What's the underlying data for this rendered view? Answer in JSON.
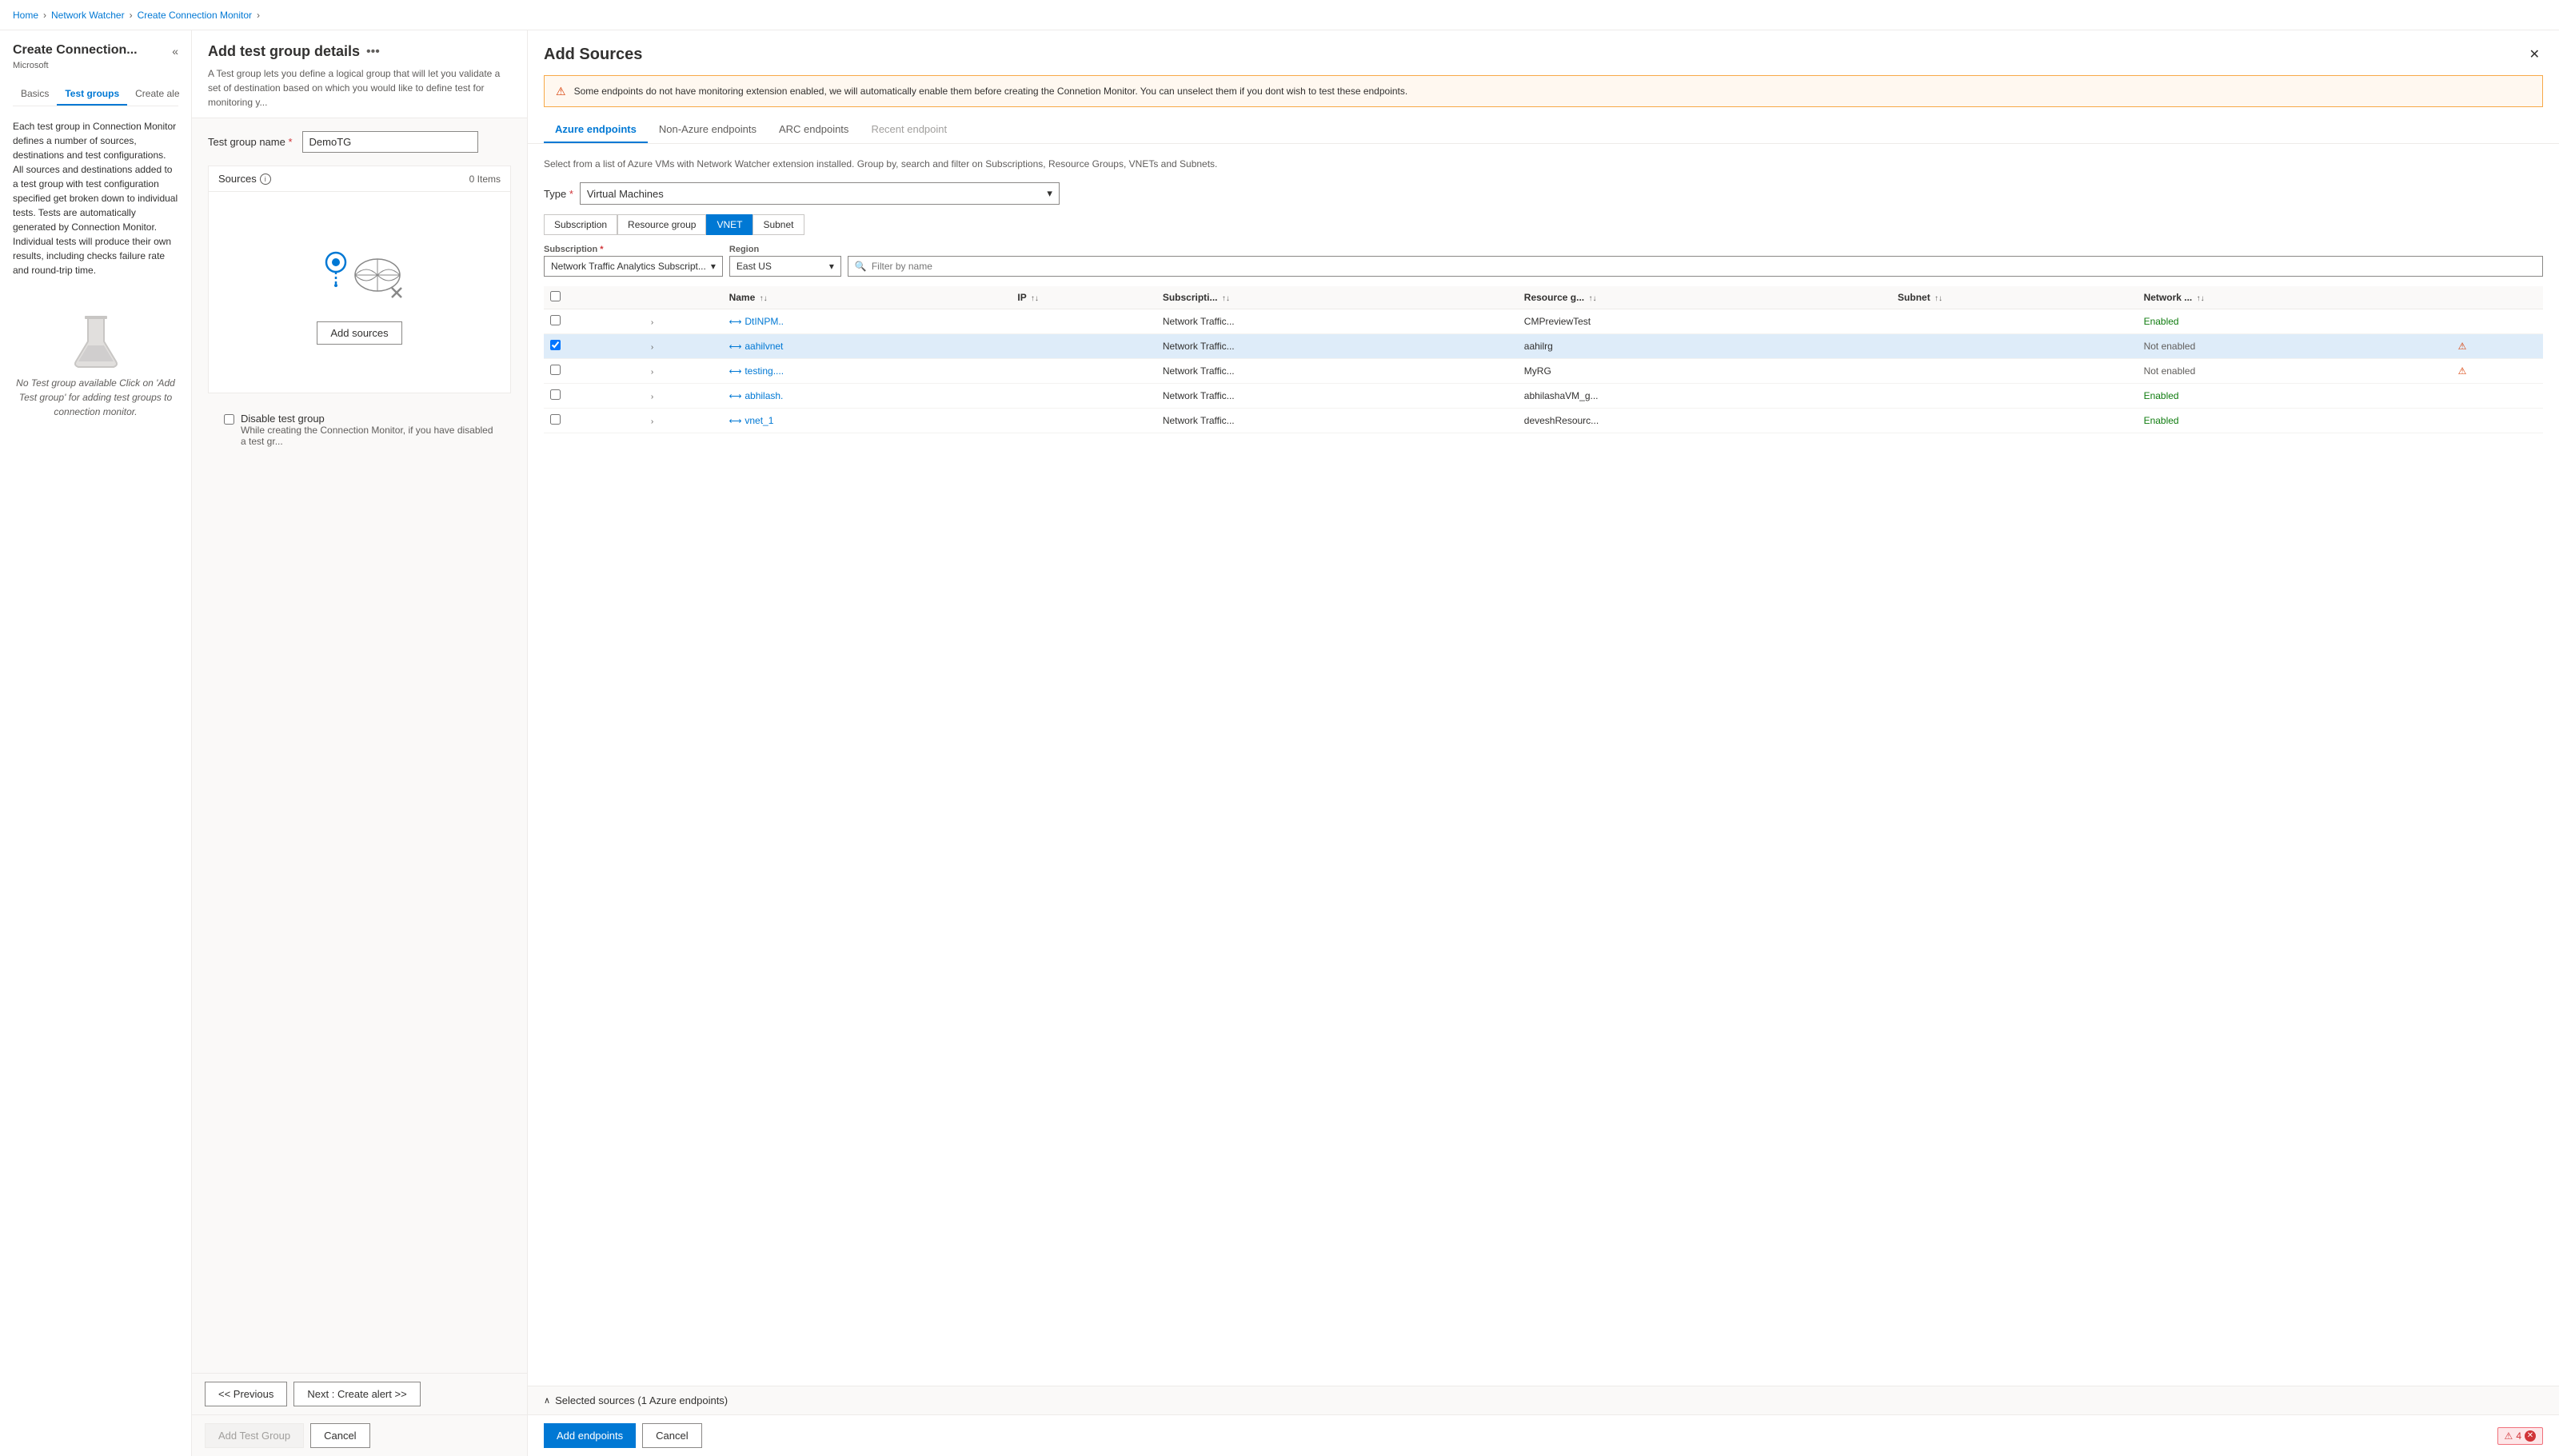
{
  "breadcrumb": {
    "items": [
      "Home",
      "Network Watcher",
      "Create Connection Monitor"
    ],
    "separators": [
      ">",
      ">",
      ">"
    ]
  },
  "sidebar": {
    "title": "Create Connection...",
    "subtitle": "Microsoft",
    "tabs": [
      {
        "id": "basics",
        "label": "Basics",
        "active": false
      },
      {
        "id": "testgroups",
        "label": "Test groups",
        "active": true
      },
      {
        "id": "createalert",
        "label": "Create ale",
        "active": false,
        "disabled": false
      }
    ],
    "more_icon": "•••",
    "description": "Each test group in Connection Monitor defines a number of sources, destinations and test configurations. All sources and destinations added to a test group with test configuration specified get broken down to individual tests. Tests are automatically generated by Connection Monitor. Individual tests will produce their own results, including checks failure rate and round-trip time.",
    "empty_state": {
      "message": "No Test group available\nClick on 'Add Test group' for adding test groups to connection monitor."
    }
  },
  "middle": {
    "title": "Add test group details",
    "more_icon": "•••",
    "description": "A Test group lets you define a logical group that will let you validate a set of destination based on which you would like to define test for monitoring y...",
    "test_group_name_label": "Test group name",
    "required_indicator": "*",
    "test_group_name_value": "DemoTG",
    "sources_section": {
      "label": "Sources",
      "count_label": "0 Items",
      "add_sources_btn": "Add sources"
    },
    "disable_checkbox": {
      "label": "Disable test group",
      "sublabel": "While creating the Connection Monitor, if you have disabled a test gr..."
    }
  },
  "right_panel": {
    "title": "Add Sources",
    "close_label": "✕",
    "warning_text": "Some endpoints do not have monitoring extension enabled, we will automatically enable them before creating the Connetion Monitor. You can unselect them if you dont wish to test these endpoints.",
    "tabs": [
      {
        "id": "azure",
        "label": "Azure endpoints",
        "active": true
      },
      {
        "id": "nonazure",
        "label": "Non-Azure endpoints",
        "active": false
      },
      {
        "id": "arc",
        "label": "ARC endpoints",
        "active": false
      },
      {
        "id": "recent",
        "label": "Recent endpoint",
        "active": false,
        "disabled": true
      }
    ],
    "description": "Select from a list of Azure VMs with Network Watcher extension installed. Group by, search and filter on Subscriptions, Resource Groups, VNETs and Subnets.",
    "type_label": "Type",
    "type_value": "Virtual Machines",
    "group_buttons": [
      {
        "id": "subscription",
        "label": "Subscription",
        "active": false
      },
      {
        "id": "resourcegroup",
        "label": "Resource group",
        "active": false
      },
      {
        "id": "vnet",
        "label": "VNET",
        "active": true
      },
      {
        "id": "subnet",
        "label": "Subnet",
        "active": false
      }
    ],
    "subscription_label": "Subscription",
    "subscription_value": "Network Traffic Analytics Subscript...",
    "region_label": "Region",
    "region_value": "East US",
    "filter_placeholder": "Filter by name",
    "table": {
      "columns": [
        {
          "id": "checkbox",
          "label": ""
        },
        {
          "id": "expand",
          "label": ""
        },
        {
          "id": "name",
          "label": "Name",
          "sortable": true
        },
        {
          "id": "ip",
          "label": "IP",
          "sortable": true
        },
        {
          "id": "subscription",
          "label": "Subscripti...",
          "sortable": true
        },
        {
          "id": "resourcegroup",
          "label": "Resource g...",
          "sortable": true
        },
        {
          "id": "subnet",
          "label": "Subnet",
          "sortable": true
        },
        {
          "id": "network",
          "label": "Network ...",
          "sortable": true
        },
        {
          "id": "warn",
          "label": ""
        }
      ],
      "rows": [
        {
          "id": "row1",
          "checked": false,
          "name": "DtINPM..",
          "ip": "",
          "subscription": "Network Traffic...",
          "resourcegroup": "CMPreviewTest",
          "subnet": "",
          "network_status": "Enabled",
          "has_warning": false,
          "selected": false
        },
        {
          "id": "row2",
          "checked": true,
          "name": "aahilvnet",
          "ip": "",
          "subscription": "Network Traffic...",
          "resourcegroup": "aahilrg",
          "subnet": "",
          "network_status": "Not enabled",
          "has_warning": true,
          "selected": true
        },
        {
          "id": "row3",
          "checked": false,
          "name": "testing....",
          "ip": "",
          "subscription": "Network Traffic...",
          "resourcegroup": "MyRG",
          "subnet": "",
          "network_status": "Not enabled",
          "has_warning": true,
          "selected": false
        },
        {
          "id": "row4",
          "checked": false,
          "name": "abhilash.",
          "ip": "",
          "subscription": "Network Traffic...",
          "resourcegroup": "abhilashaVM_g...",
          "subnet": "",
          "network_status": "Enabled",
          "has_warning": false,
          "selected": false
        },
        {
          "id": "row5",
          "checked": false,
          "name": "vnet_1",
          "ip": "",
          "subscription": "Network Traffic...",
          "resourcegroup": "deveshResourc...",
          "subnet": "",
          "network_status": "Enabled",
          "has_warning": false,
          "selected": false
        }
      ]
    },
    "selected_footer": "Selected sources (1 Azure endpoints)",
    "add_endpoints_btn": "Add endpoints",
    "cancel_btn": "Cancel"
  },
  "bottom_bar": {
    "previous_btn": "<< Previous",
    "next_btn": "Next : Create alert >>",
    "add_test_group_btn": "Add Test Group",
    "cancel_btn": "Cancel"
  },
  "error_badge": {
    "count": "4",
    "icon": "⚠"
  }
}
